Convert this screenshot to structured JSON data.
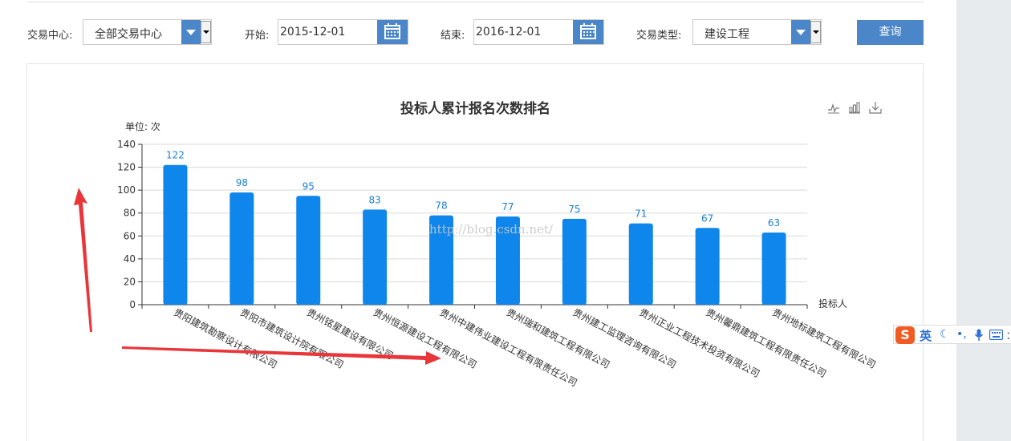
{
  "filters": {
    "center_label": "交易中心:",
    "center_value": "全部交易中心",
    "start_label": "开始:",
    "start_value": "2015-12-01",
    "end_label": "结束:",
    "end_value": "2016-12-01",
    "type_label": "交易类型:",
    "type_value": "建设工程",
    "query_label": "查询"
  },
  "toolbox": {
    "icons": [
      "line-chart-icon",
      "bar-chart-icon",
      "download-icon"
    ]
  },
  "watermark": "http://blog.csdn.net/",
  "ime": {
    "logo": "S",
    "mode": "英"
  },
  "colors": {
    "bar": "#0f86eb",
    "label": "#1a7fd4",
    "accent": "#4a86c8",
    "arrow": "#e8363a"
  },
  "chart_data": {
    "type": "bar",
    "title": "投标人累计报名次数排名",
    "ylabel": "单位: 次",
    "xlabel": "投标人",
    "ylim": [
      0,
      140
    ],
    "yticks": [
      0,
      20,
      40,
      60,
      80,
      100,
      120,
      140
    ],
    "grid": true,
    "categories": [
      "贵阳建筑勘察设计有限公司",
      "贵阳市建筑设计院有限公司",
      "贵州铭星建设有限公司",
      "贵州恒源建设工程有限公司",
      "贵州中建伟业建设工程有限责任公司",
      "贵州瑞和建筑工程有限公司",
      "贵州建工监理咨询有限公司",
      "贵州正业工程技术投资有限公司",
      "贵州馨鼎建筑工程有限责任公司",
      "贵州地标建筑工程有限公司"
    ],
    "values": [
      122,
      98,
      95,
      83,
      78,
      77,
      75,
      71,
      67,
      63
    ]
  }
}
